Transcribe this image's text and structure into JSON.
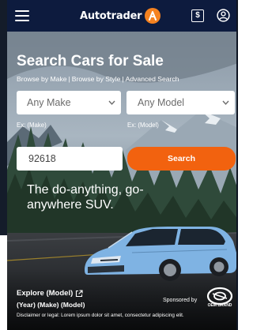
{
  "header": {
    "brand_name": "Autotrader",
    "icons": [
      "menu-icon",
      "autotrader-logo-icon",
      "dealer-price-icon",
      "account-icon"
    ],
    "brand_color": "#f58220",
    "background_color": "#0d1b3e"
  },
  "search": {
    "title": "Search Cars for Sale",
    "links": [
      "Browse by Make",
      "Browse by Style",
      "Advanced Search"
    ],
    "make_select": {
      "value": "Any Make",
      "hint": "Ex: (Make)"
    },
    "model_select": {
      "value": "Any Model",
      "hint": "Ex: (Model)"
    },
    "zip_input": {
      "value": "92618"
    },
    "search_button_label": "Search",
    "button_color": "#f2620f"
  },
  "ad": {
    "tagline": "The do-anything, go-anywhere SUV.",
    "explore_link": "Explore (Model)",
    "year_make_model": "(Year) (Make) (Model)",
    "disclaimer": "Disclaimer or legal: Lorem ipsum dolor sit amet, consectetur adipiscing elit.",
    "sponsored_by": "Sponsored by",
    "sponsor_logo_text": "OEM BRAND",
    "car_color": "#7fb3e3"
  }
}
